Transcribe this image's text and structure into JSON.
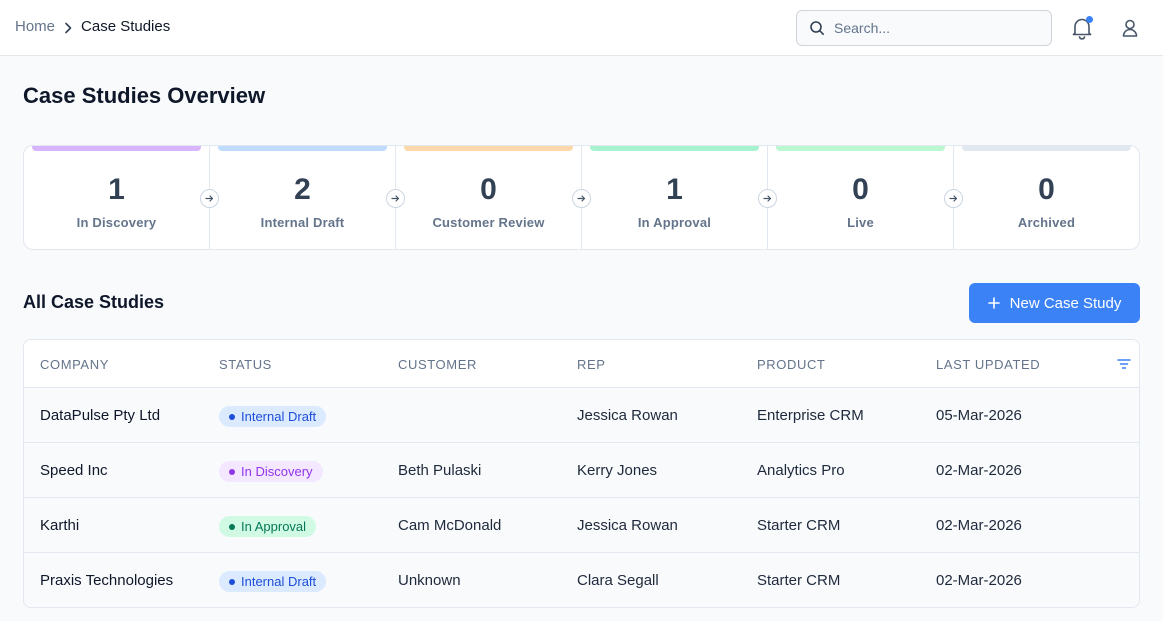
{
  "breadcrumb": {
    "home": "Home",
    "current": "Case Studies"
  },
  "search": {
    "placeholder": "Search..."
  },
  "page_title": "Case Studies Overview",
  "pipeline": [
    {
      "count": "1",
      "label": "In Discovery",
      "color": "#d8b4fe"
    },
    {
      "count": "2",
      "label": "Internal Draft",
      "color": "#bfdbfe"
    },
    {
      "count": "0",
      "label": "Customer Review",
      "color": "#fed7aa"
    },
    {
      "count": "1",
      "label": "In Approval",
      "color": "#a7f3d0"
    },
    {
      "count": "0",
      "label": "Live",
      "color": "#bbf7d0"
    },
    {
      "count": "0",
      "label": "Archived",
      "color": "#e2e8f0"
    }
  ],
  "section_title": "All Case Studies",
  "new_button": "New Case Study",
  "table": {
    "headers": [
      "COMPANY",
      "STATUS",
      "CUSTOMER",
      "REP",
      "PRODUCT",
      "LAST UPDATED"
    ],
    "rows": [
      {
        "company": "DataPulse Pty Ltd",
        "status": "Internal Draft",
        "customer": "",
        "rep": "Jessica Rowan",
        "product": "Enterprise CRM",
        "updated": "05-Mar-2026"
      },
      {
        "company": "Speed Inc",
        "status": "In Discovery",
        "customer": "Beth Pulaski",
        "rep": "Kerry Jones",
        "product": "Analytics Pro",
        "updated": "02-Mar-2026"
      },
      {
        "company": "Karthi",
        "status": "In Approval",
        "customer": "Cam McDonald",
        "rep": "Jessica Rowan",
        "product": "Starter CRM",
        "updated": "02-Mar-2026"
      },
      {
        "company": "Praxis Technologies",
        "status": "Internal Draft",
        "customer": "Unknown",
        "rep": "Clara Segall",
        "product": "Starter CRM",
        "updated": "02-Mar-2026"
      }
    ]
  },
  "colors": {
    "accent": "#3b82f6",
    "notification_dot": "#3b82f6"
  }
}
